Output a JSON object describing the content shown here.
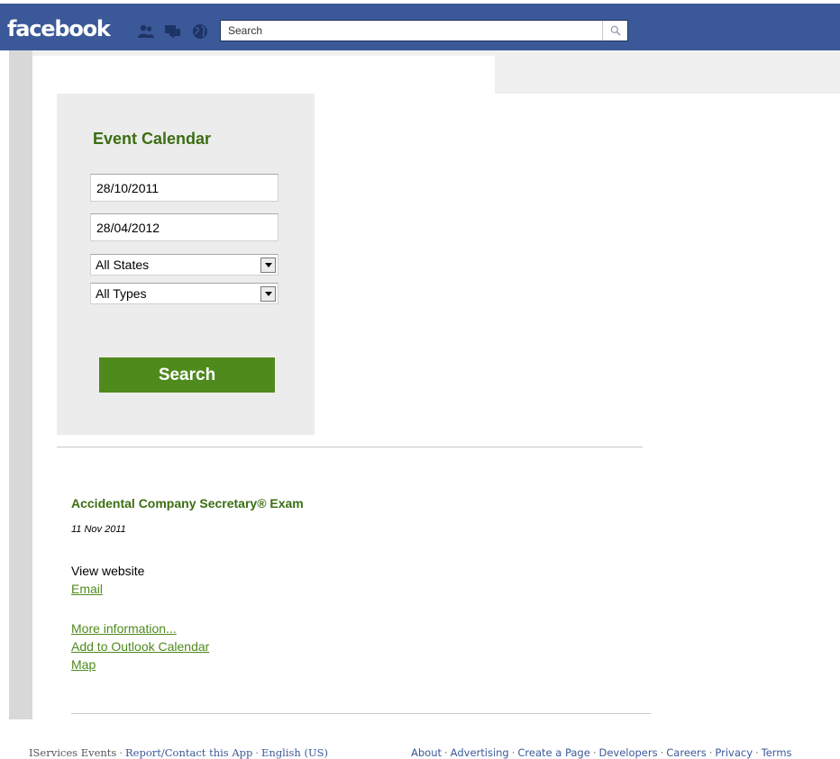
{
  "header": {
    "logo": "facebook",
    "search_placeholder": "Search",
    "icons": [
      "friends-icon",
      "messages-icon",
      "notifications-globe-icon",
      "magnifier-icon"
    ],
    "colors": {
      "brand_blue": "#3b5998"
    }
  },
  "calendar": {
    "title": "Event Calendar",
    "start_date": "28/10/2011",
    "end_date": "28/04/2012",
    "state_select": "All States",
    "type_select": "All Types",
    "search_label": "Search",
    "colors": {
      "accent_green": "#4f8a1c",
      "title_green": "#3b6e12"
    }
  },
  "event": {
    "title": "Accidental Company Secretary® Exam",
    "date": "11 Nov 2011",
    "view_website": "View website",
    "email": "Email",
    "more_info": "More information...",
    "add_outlook": "Add to Outlook Calendar",
    "map": "Map"
  },
  "footer": {
    "app_name": "IServices Events",
    "report": "Report/Contact this App",
    "language": "English (US)",
    "links": [
      "About",
      "Advertising",
      "Create a Page",
      "Developers",
      "Careers",
      "Privacy",
      "Terms"
    ]
  }
}
